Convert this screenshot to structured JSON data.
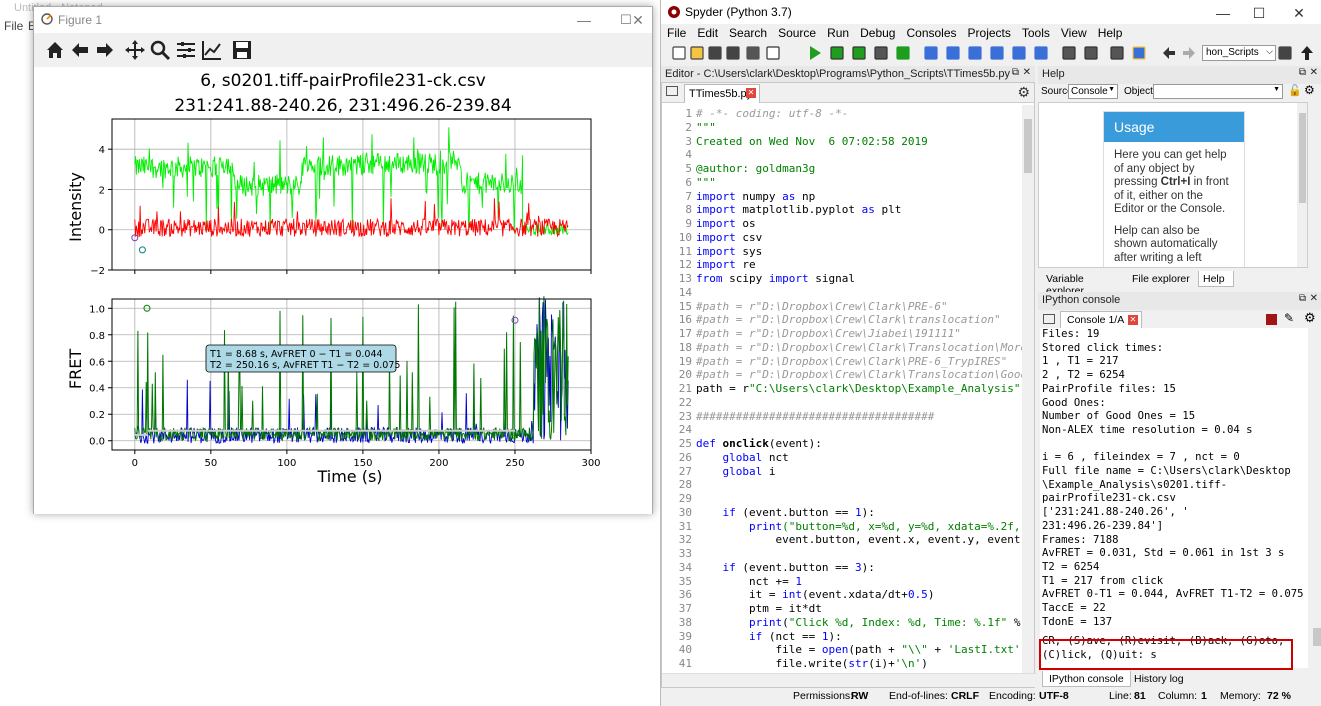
{
  "background": {
    "title": "Untitled - Notepad",
    "menu": [
      "File",
      "E"
    ]
  },
  "figure": {
    "window_title": "Figure 1",
    "toolbar": [
      "home-icon",
      "back-arrow-icon",
      "forward-arrow-icon",
      "pan-icon",
      "zoom-icon",
      "subplots-config-icon",
      "axes-edit-icon",
      "save-icon"
    ],
    "title_line1": "6,  s0201.tiff-pairProfile231-ck.csv",
    "title_line2": "231:241.88-240.26,    231:496.26-239.84",
    "intensity_ylabel": "Intensity",
    "fret_ylabel": "FRET",
    "xlabel": "Time (s)",
    "annotation_line1": "T1 = 8.68 s, AvFRET  0 − T1  = 0.044",
    "annotation_line2": "T2 = 250.16 s, AvFRET T1 − T2 = 0.075"
  },
  "chart_data": [
    {
      "type": "line",
      "ylabel": "Intensity",
      "xlim": [
        -15,
        300
      ],
      "ylim": [
        -2,
        5.5
      ],
      "xticks": [
        0,
        50,
        100,
        150,
        200,
        250,
        300
      ],
      "yticks": [
        -2,
        0,
        2,
        4
      ],
      "grid": true,
      "series": [
        {
          "color": "#00ee00",
          "level_x": [
            0,
            55,
            65,
            110,
            150,
            205,
            215,
            255
          ],
          "level_y": [
            3.1,
            3.3,
            2.2,
            3.2,
            3.3,
            3.4,
            2.3,
            3.2
          ]
        },
        {
          "color": "#ff0000",
          "level_x": [
            0,
            250,
            285
          ],
          "level_y": [
            0.1,
            0.1,
            0.0
          ]
        }
      ],
      "markers": [
        {
          "x": 0,
          "y": -0.4,
          "color": "#7f3fbf"
        },
        {
          "x": 5,
          "y": -1.0,
          "color": "#008080"
        }
      ]
    },
    {
      "type": "line",
      "ylabel": "FRET",
      "xlabel": "Time (s)",
      "xlim": [
        -15,
        300
      ],
      "ylim": [
        -0.07,
        1.07
      ],
      "xticks": [
        0,
        50,
        100,
        150,
        200,
        250,
        300
      ],
      "xticklabels": [
        "0",
        "50",
        "100",
        "150",
        "200",
        "250",
        "300"
      ],
      "yticks": [
        0.0,
        0.2,
        0.4,
        0.6,
        0.8,
        1.0
      ],
      "yticklabels": [
        "0.0",
        "0.2",
        "0.4",
        "0.6",
        "0.8",
        "1.0"
      ],
      "grid": true,
      "series": [
        {
          "color": "#0000cc",
          "baseline": 0.04
        },
        {
          "color": "#007700",
          "baseline": 0.05
        },
        {
          "color": "#cccccc",
          "segments": [
            [
              0,
              8.68,
              0.044
            ],
            [
              8.68,
              250.16,
              0.075
            ]
          ]
        }
      ],
      "markers": [
        {
          "x": 8,
          "y": 1.0,
          "color": "#008000"
        },
        {
          "x": 250,
          "y": 0.91,
          "color": "#7f3fbf"
        }
      ]
    }
  ],
  "spyder": {
    "window_title": "Spyder (Python 3.7)",
    "menu": [
      "File",
      "Edit",
      "Search",
      "Source",
      "Run",
      "Debug",
      "Consoles",
      "Projects",
      "Tools",
      "View",
      "Help"
    ],
    "path_combo": "hon_Scripts",
    "editor_header": "Editor - C:\\Users\\clark\\Desktop\\Programs\\Python_Scripts\\TTimes5b.py",
    "editor_tab": "TTimes5b.py",
    "code": [
      {
        "n": "1",
        "segs": [
          [
            "cm",
            "# -*- coding: utf-8 -*-"
          ]
        ]
      },
      {
        "n": "2",
        "segs": [
          [
            "st",
            "\"\"\""
          ]
        ]
      },
      {
        "n": "3",
        "segs": [
          [
            "st",
            "Created on Wed Nov  6 07:02:58 2019"
          ]
        ]
      },
      {
        "n": "4",
        "segs": [
          [
            "",
            ""
          ]
        ]
      },
      {
        "n": "5",
        "segs": [
          [
            "st",
            "@author: goldman3g"
          ]
        ]
      },
      {
        "n": "6",
        "segs": [
          [
            "st",
            "\"\"\""
          ]
        ]
      },
      {
        "n": "7",
        "segs": [
          [
            "kw",
            "import"
          ],
          [
            "",
            " numpy "
          ],
          [
            "kw",
            "as"
          ],
          [
            "",
            " np"
          ]
        ]
      },
      {
        "n": "8",
        "segs": [
          [
            "kw",
            "import"
          ],
          [
            "",
            " matplotlib.pyplot "
          ],
          [
            "kw",
            "as"
          ],
          [
            "",
            " plt"
          ]
        ]
      },
      {
        "n": "9",
        "segs": [
          [
            "kw",
            "import"
          ],
          [
            "",
            " os"
          ]
        ]
      },
      {
        "n": "10",
        "segs": [
          [
            "kw",
            "import"
          ],
          [
            "",
            " csv"
          ]
        ]
      },
      {
        "n": "11",
        "segs": [
          [
            "kw",
            "import"
          ],
          [
            "",
            " sys"
          ]
        ]
      },
      {
        "n": "12",
        "segs": [
          [
            "kw",
            "import"
          ],
          [
            "",
            " re"
          ]
        ]
      },
      {
        "n": "13",
        "segs": [
          [
            "kw",
            "from"
          ],
          [
            "",
            " scipy "
          ],
          [
            "kw",
            "import"
          ],
          [
            "",
            " signal"
          ]
        ]
      },
      {
        "n": "14",
        "segs": [
          [
            "",
            ""
          ]
        ]
      },
      {
        "n": "15",
        "segs": [
          [
            "cm",
            "#path = r\"D:\\Dropbox\\Crew\\Clark\\PRE-6\""
          ]
        ]
      },
      {
        "n": "16",
        "segs": [
          [
            "cm",
            "#path = r\"D:\\Dropbox\\Crew\\Clark\\translocation\""
          ]
        ]
      },
      {
        "n": "17",
        "segs": [
          [
            "cm",
            "#path = r\"D:\\Dropbox\\Crew\\Jiabei\\191111\""
          ]
        ]
      },
      {
        "n": "18",
        "segs": [
          [
            "cm",
            "#path = r\"D:\\Dropbox\\Crew\\Clark\\Translocation\\More_"
          ]
        ]
      },
      {
        "n": "19",
        "segs": [
          [
            "cm",
            "#path = r\"D:\\Dropbox\\Crew\\Clark\\PRE-6_TrypIRES\""
          ]
        ]
      },
      {
        "n": "20",
        "segs": [
          [
            "cm",
            "#path = r\"D:\\Dropbox\\Crew\\Clark\\Translocation\\Good_"
          ]
        ]
      },
      {
        "n": "21",
        "segs": [
          [
            "",
            "path = r"
          ],
          [
            "st",
            "\"C:\\Users\\clark\\Desktop\\Example_Analysis\""
          ]
        ]
      },
      {
        "n": "22",
        "segs": [
          [
            "",
            ""
          ]
        ]
      },
      {
        "n": "23",
        "segs": [
          [
            "cm",
            "####################################"
          ]
        ]
      },
      {
        "n": "24",
        "segs": [
          [
            "",
            ""
          ]
        ]
      },
      {
        "n": "25",
        "segs": [
          [
            "kw",
            "def"
          ],
          [
            "df",
            " onclick"
          ],
          [
            "",
            "(event):"
          ]
        ]
      },
      {
        "n": "26",
        "segs": [
          [
            "",
            "    "
          ],
          [
            "kw",
            "global"
          ],
          [
            "",
            " nct"
          ]
        ]
      },
      {
        "n": "27",
        "segs": [
          [
            "",
            "    "
          ],
          [
            "kw",
            "global"
          ],
          [
            "",
            " i"
          ]
        ]
      },
      {
        "n": "28",
        "segs": [
          [
            "",
            ""
          ]
        ]
      },
      {
        "n": "29",
        "segs": [
          [
            "",
            ""
          ]
        ]
      },
      {
        "n": "30",
        "segs": [
          [
            "",
            "    "
          ],
          [
            "kw",
            "if"
          ],
          [
            "",
            " (event.button == "
          ],
          [
            "kw",
            "1"
          ],
          [
            "",
            "):"
          ]
        ]
      },
      {
        "n": "31",
        "segs": [
          [
            "",
            "        "
          ],
          [
            "kw",
            "print"
          ],
          [
            "st",
            "(\"button=%d, x=%d, y=%d, xdata=%.2f, y"
          ]
        ]
      },
      {
        "n": "32",
        "segs": [
          [
            "",
            "            event.button, event.x, event.y, event.x"
          ]
        ]
      },
      {
        "n": "33",
        "segs": [
          [
            "",
            ""
          ]
        ]
      },
      {
        "n": "34",
        "segs": [
          [
            "",
            "    "
          ],
          [
            "kw",
            "if"
          ],
          [
            "",
            " (event.button == "
          ],
          [
            "kw",
            "3"
          ],
          [
            "",
            "):"
          ]
        ]
      },
      {
        "n": "35",
        "segs": [
          [
            "",
            "        nct += "
          ],
          [
            "kw",
            "1"
          ]
        ]
      },
      {
        "n": "36",
        "segs": [
          [
            "",
            "        it = "
          ],
          [
            "kw",
            "int"
          ],
          [
            "",
            "(event.xdata/dt+"
          ],
          [
            "kw",
            "0.5"
          ],
          [
            "",
            ")"
          ]
        ]
      },
      {
        "n": "37",
        "segs": [
          [
            "",
            "        ptm = it*dt"
          ]
        ]
      },
      {
        "n": "38",
        "segs": [
          [
            "",
            "        "
          ],
          [
            "kw",
            "print"
          ],
          [
            "",
            "("
          ],
          [
            "st",
            "\"Click %d, Index: %d, Time: %.1f\""
          ],
          [
            "",
            " % ("
          ]
        ]
      },
      {
        "n": "39",
        "segs": [
          [
            "",
            "        "
          ],
          [
            "kw",
            "if"
          ],
          [
            "",
            " (nct == "
          ],
          [
            "kw",
            "1"
          ],
          [
            "",
            "):"
          ]
        ]
      },
      {
        "n": "40",
        "segs": [
          [
            "",
            "            file = "
          ],
          [
            "kw",
            "open"
          ],
          [
            "",
            "(path + "
          ],
          [
            "st",
            "\"\\\\\""
          ],
          [
            "",
            " + "
          ],
          [
            "st",
            "'LastI.txt'"
          ],
          [
            "",
            ","
          ]
        ]
      },
      {
        "n": "41",
        "segs": [
          [
            "",
            "            file.write("
          ],
          [
            "kw",
            "str"
          ],
          [
            "",
            "(i)+"
          ],
          [
            "st",
            "'\\n'"
          ],
          [
            "",
            ")"
          ]
        ]
      }
    ],
    "help": {
      "header": "Help",
      "source_label": "Source",
      "source_value": "Console",
      "object_label": "Object",
      "usage_title": "Usage",
      "usage_p1_a": "Here you can get help of any object by pressing ",
      "usage_p1_b": "Ctrl+I",
      "usage_p1_c": " in front of it, either on the Editor or the Console.",
      "usage_p2": "Help can also be shown automatically after writing a left",
      "tabs": [
        "Variable explorer",
        "File explorer",
        "Help"
      ]
    },
    "console": {
      "header": "IPython console",
      "tab": "Console 1/A",
      "lines": [
        "Files:  19",
        "Stored click times:",
        "1 , T1 = 217",
        "2 , T2 = 6254",
        "PairProfile files:  15",
        "Good Ones:",
        "Number of Good Ones = 15",
        "Non-ALEX time resolution =  0.04  s",
        "",
        "i = 6 , fileindex = 7 , nct = 0",
        "Full file name =  C:\\Users\\clark\\Desktop",
        "\\Example_Analysis\\s0201.tiff-",
        "pairProfile231-ck.csv",
        "['231:241.88-240.26', '",
        "231:496.26-239.84']",
        "Frames:  7188",
        "AvFRET = 0.031, Std = 0.061 in 1st 3 s",
        "T2 =  6254",
        "T1 =  217 from click",
        "AvFRET 0-T1 = 0.044, AvFRET T1-T2 = 0.075",
        "TaccE =  22",
        "TdonE =  137"
      ],
      "prompt_line1": "CR, (S)ave, (R)evisit, (B)ack, (G)oto,",
      "prompt_line2": "(C)lick, (Q)uit: s",
      "tabs": [
        "IPython console",
        "History log"
      ]
    },
    "status": {
      "permissions_label": "Permissions:",
      "permissions": "RW",
      "eol_label": "End-of-lines:",
      "eol": "CRLF",
      "encoding_label": "Encoding:",
      "encoding": "UTF-8",
      "line_label": "Line:",
      "line": "81",
      "column_label": "Column:",
      "column": "1",
      "memory_label": "Memory:",
      "memory": "72 %"
    }
  }
}
